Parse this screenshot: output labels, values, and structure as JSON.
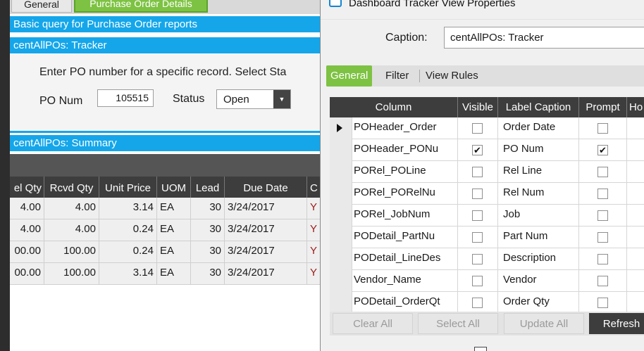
{
  "left_window": {
    "tabs": [
      "General",
      "Purchase Order Details"
    ],
    "query_bar": "Basic query for Purchase Order reports",
    "tracker_bar": "centAllPOs: Tracker",
    "instruction": "Enter PO number for a specific record. Select Sta",
    "po_num_label": "PO Num",
    "po_num_value": "105515",
    "status_label": "Status",
    "status_value": "Open",
    "summary_bar": "centAllPOs: Summary",
    "grid": {
      "headers": [
        "el Qty",
        "Rcvd Qty",
        "Unit Price",
        "UOM",
        "Lead",
        "Due Date",
        "C"
      ],
      "rows": [
        [
          "4.00",
          "4.00",
          "3.14",
          "EA",
          "30",
          "3/24/2017",
          "Y"
        ],
        [
          "4.00",
          "4.00",
          "0.24",
          "EA",
          "30",
          "3/24/2017",
          "Y"
        ],
        [
          "00.00",
          "100.00",
          "0.24",
          "EA",
          "30",
          "3/24/2017",
          "Y"
        ],
        [
          "00.00",
          "100.00",
          "3.14",
          "EA",
          "30",
          "3/24/2017",
          "Y"
        ]
      ]
    }
  },
  "dialog": {
    "title": "Dashboard Tracker View Properties",
    "caption_label": "Caption:",
    "caption_value": "centAllPOs: Tracker",
    "tabs": [
      "General",
      "Filter",
      "View Rules"
    ],
    "columns_header": [
      "Column",
      "Visible",
      "Label Caption",
      "Prompt",
      "Ho"
    ],
    "rows": [
      {
        "column": "POHeader_Order",
        "visible": false,
        "label": "Order Date",
        "prompt": false
      },
      {
        "column": "POHeader_PONu",
        "visible": true,
        "label": "PO Num",
        "prompt": true
      },
      {
        "column": "PORel_POLine",
        "visible": false,
        "label": "Rel Line",
        "prompt": false
      },
      {
        "column": "PORel_PORelNu",
        "visible": false,
        "label": "Rel Num",
        "prompt": false
      },
      {
        "column": "PORel_JobNum",
        "visible": false,
        "label": "Job",
        "prompt": false
      },
      {
        "column": "PODetail_PartNu",
        "visible": false,
        "label": "Part Num",
        "prompt": false
      },
      {
        "column": "PODetail_LineDes",
        "visible": false,
        "label": "Description",
        "prompt": false
      },
      {
        "column": "Vendor_Name",
        "visible": false,
        "label": "Vendor",
        "prompt": false
      },
      {
        "column": "PODetail_OrderQt",
        "visible": false,
        "label": "Order Qty",
        "prompt": false
      }
    ],
    "buttons": [
      "Clear All",
      "Select All",
      "Update All",
      "Refresh"
    ],
    "check_mark": "✔"
  },
  "colors": {
    "accent_blue": "#15a6ea",
    "tab_green": "#7dc242",
    "grid_header": "#3d3d3d",
    "flag_red": "#a01c1c"
  }
}
